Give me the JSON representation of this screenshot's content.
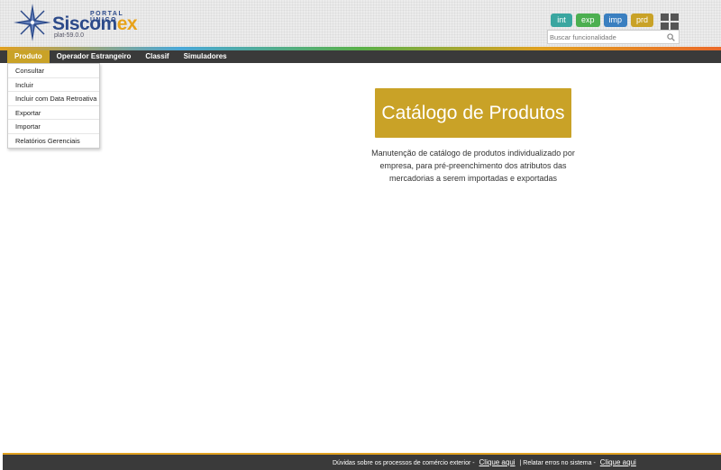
{
  "header": {
    "logo": {
      "portal_label": "PORTAL ÚNICO",
      "name_main": "Siscom",
      "name_accent": "ex",
      "version": "plat-59.0.0"
    },
    "env_badges": [
      {
        "label": "int",
        "color": "#3aa6a0"
      },
      {
        "label": "exp",
        "color": "#4caf50"
      },
      {
        "label": "imp",
        "color": "#3a7fc0"
      },
      {
        "label": "prd",
        "color": "#c9a227"
      }
    ],
    "search": {
      "placeholder": "Buscar funcionalidade"
    },
    "apps_icon": "grid-icon"
  },
  "menubar": {
    "items": [
      {
        "label": "Produto",
        "active": true
      },
      {
        "label": "Operador Estrangeiro"
      },
      {
        "label": "Classif"
      },
      {
        "label": "Simuladores"
      }
    ]
  },
  "dropdown": {
    "items": [
      "Consultar",
      "Incluir",
      "Incluir com Data Retroativa",
      "Exportar",
      "Importar",
      "Relatórios Gerenciais"
    ]
  },
  "main": {
    "catalog_button": "Catálogo de Produtos",
    "description": "Manutenção de catálogo de produtos individualizado por empresa, para pré-preenchimento dos atributos das mercadorias a serem importadas e exportadas"
  },
  "footer": {
    "text1": "Dúvidas sobre os processos de comércio exterior -",
    "link1": "Clique aqui",
    "text2": "| Relatar erros no sistema -",
    "link2": "Clique aqui"
  },
  "colors": {
    "accent": "#c9a227",
    "menubar": "#3a3a3a",
    "brand_blue": "#2c4a8a"
  }
}
